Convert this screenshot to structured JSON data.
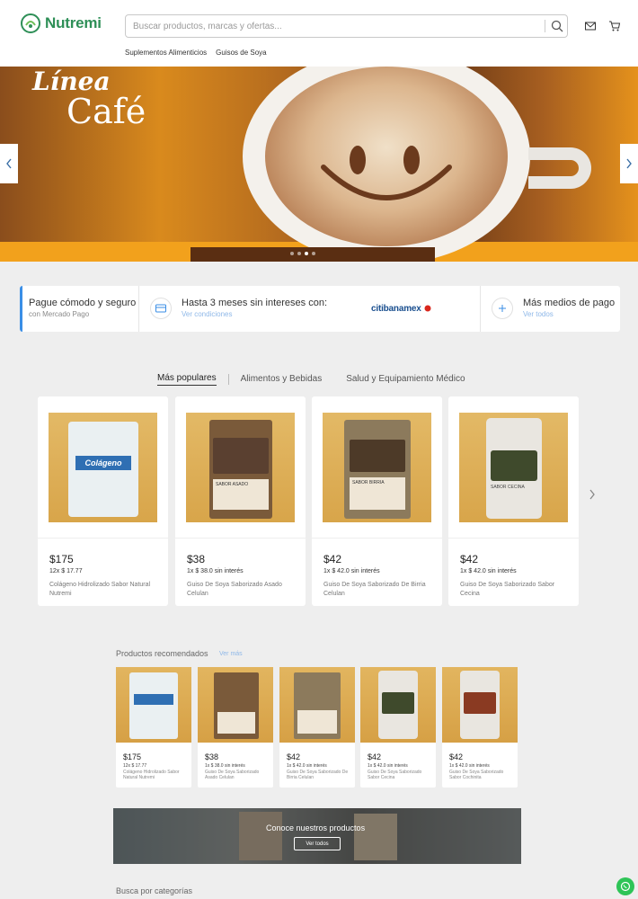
{
  "brand": {
    "name": "Nutremi"
  },
  "search": {
    "placeholder": "Buscar productos, marcas y ofertas..."
  },
  "header_icons": [
    "search-icon",
    "mail-icon",
    "cart-icon"
  ],
  "nav": {
    "items": [
      "Suplementos Alimenticios",
      "Guisos de Soya"
    ]
  },
  "hero": {
    "line1": "Línea",
    "line2": "Café",
    "slides": 4,
    "active_slide": 3
  },
  "payment": {
    "block1": {
      "title": "Pague cómodo y seguro",
      "subtitle": "con Mercado Pago"
    },
    "block2": {
      "title": "Hasta 3 meses sin intereses con:",
      "link": "Ver condiciones",
      "bank": "citibanamex"
    },
    "block3": {
      "title": "Más medios de pago",
      "link": "Ver todos"
    }
  },
  "tabs": {
    "items": [
      "Más populares",
      "Alimentos y Bebidas",
      "Salud y Equipamiento Médico"
    ],
    "active": 0
  },
  "popular": [
    {
      "price": "$175",
      "installments": "12x $ 17.77",
      "name": "Colágeno Hidrolizado Sabor Natural Nutremi",
      "label": "Colágeno"
    },
    {
      "price": "$38",
      "installments": "1x $ 38.0 sin interés",
      "name": "Guiso De Soya Saborizado Asado Celulan",
      "label": "SABOR ASADO"
    },
    {
      "price": "$42",
      "installments": "1x $ 42.0 sin interés",
      "name": "Guiso De Soya Saborizado De Birria Celulan",
      "label": "SABOR BIRRIA"
    },
    {
      "price": "$42",
      "installments": "1x $ 42.0 sin interés",
      "name": "Guiso De Soya Saborizado Sabor Cecina",
      "label": "SABOR CECINA"
    }
  ],
  "recommended": {
    "title": "Productos recomendados",
    "link": "Ver más",
    "items": [
      {
        "price": "$175",
        "installments": "12x $ 17.77",
        "name": "Colágeno Hidrolizado Sabor Natural Nutremi"
      },
      {
        "price": "$38",
        "installments": "1x $ 38.0 sin interés",
        "name": "Guiso De Soya Saborizado Asado Celulan"
      },
      {
        "price": "$42",
        "installments": "1x $ 42.0 sin interés",
        "name": "Guiso De Soya Saborizado De Birria Celulan"
      },
      {
        "price": "$42",
        "installments": "1x $ 42.0 sin interés",
        "name": "Guiso De Soya Saborizado Sabor Cecina"
      },
      {
        "price": "$42",
        "installments": "1x $ 42.0 sin interés",
        "name": "Guiso De Soya Saborizado Sabor Cochinita"
      }
    ]
  },
  "products_banner": {
    "title": "Conoce nuestros productos",
    "button": "Ver todos"
  },
  "categories": {
    "title": "Busca por categorías"
  },
  "colors": {
    "brand_green": "#2e8f57",
    "accent_blue": "#3a8ee6",
    "whatsapp": "#2ec457"
  }
}
